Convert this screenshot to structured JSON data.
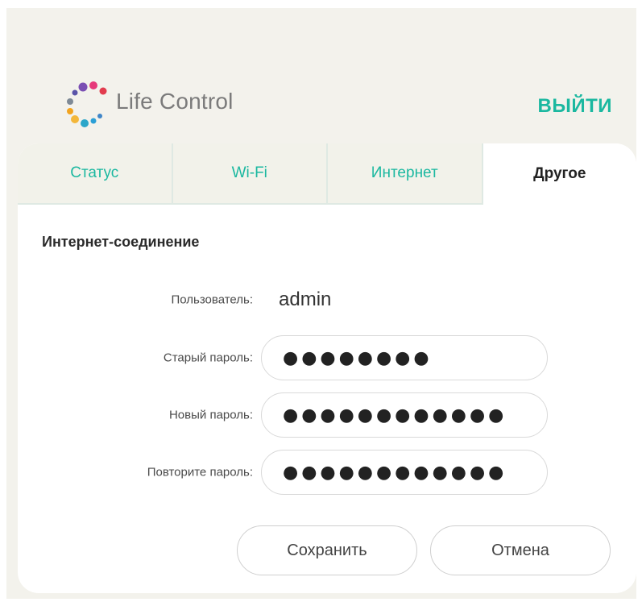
{
  "header": {
    "logo_text": "Life Control",
    "logout_label": "ВЫЙТИ"
  },
  "tabs": [
    {
      "label": "Статус",
      "active": false
    },
    {
      "label": "Wi-Fi",
      "active": false
    },
    {
      "label": "Интернет",
      "active": false
    },
    {
      "label": "Другое",
      "active": true
    }
  ],
  "section": {
    "title": "Интернет-соединение"
  },
  "form": {
    "user_label": "Пользователь:",
    "user_value": "admin",
    "old_password_label": "Старый пароль:",
    "old_password_value": "●●●●●●●●",
    "new_password_label": "Новый пароль:",
    "new_password_value": "●●●●●●●●●●●●",
    "repeat_password_label": "Повторите пароль:",
    "repeat_password_value": "●●●●●●●●●●●●"
  },
  "buttons": {
    "save_label": "Сохранить",
    "cancel_label": "Отмена"
  },
  "colors": {
    "accent": "#1bb8a0",
    "background": "#f3f2ec"
  },
  "icons": {
    "logo": "dots-ring-logo-icon"
  }
}
